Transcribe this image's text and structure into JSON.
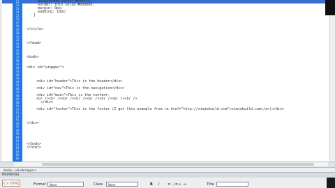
{
  "line_numbers": [
    "21",
    "22",
    "23",
    "24",
    "25",
    "26",
    "27",
    "28",
    "29",
    "30",
    "31",
    "32",
    "33",
    "34",
    "35",
    "36",
    "37",
    "38",
    "39",
    "40",
    "41",
    "42",
    "43",
    "44",
    "45",
    "46",
    "47",
    "48",
    "49",
    "50",
    "51",
    "52",
    "53",
    "54",
    "55",
    "56",
    "57",
    "58",
    "59",
    "60",
    "61",
    "62",
    "63",
    "64",
    "65",
    "66"
  ],
  "code_lines": [
    {
      "text": "background-color: #FFFFCC;",
      "indent": 54,
      "row": 0
    },
    {
      "text": "border: thin solid #000000;",
      "indent": 54,
      "row": 1
    },
    {
      "text": "margin: 0px;",
      "indent": 54,
      "row": 2
    },
    {
      "text": "padding: 10px;",
      "indent": 54,
      "row": 3
    },
    {
      "text": "}",
      "indent": 48,
      "row": 4
    },
    {
      "text": "</style>",
      "indent": 38,
      "row": 8
    },
    {
      "text": "</head>",
      "indent": 38,
      "row": 12
    },
    {
      "text": "<body>",
      "indent": 38,
      "row": 16
    },
    {
      "text": "<div id=\"wrapper\">",
      "indent": 38,
      "row": 19
    },
    {
      "text": "<div id=\"header\">This is the header</div>",
      "indent": 52,
      "row": 23
    },
    {
      "text": "<div id=\"nav\">This is the navigation</div>",
      "indent": 52,
      "row": 25
    },
    {
      "text": "<div id=\"main\">This is the content.",
      "indent": 52,
      "row": 27
    },
    {
      "text": "<br /><br /><br /><br /><br /><br /><br /><br />",
      "indent": 52,
      "row": 28
    },
    {
      "text": "</div>",
      "indent": 58,
      "row": 29
    },
    {
      "text": "<div id=\"footer\">This is the footer (I got this example from <a href=\"http://simiebuild.com\">simiebuild.com</a>)</div>",
      "indent": 52,
      "row": 31
    },
    {
      "text": "</div>",
      "indent": 38,
      "row": 35
    },
    {
      "text": "</body>",
      "indent": 38,
      "row": 41
    },
    {
      "text": "</html>",
      "indent": 38,
      "row": 42
    }
  ],
  "tag_selector": "<body> <div#wrapper>",
  "properties": {
    "panel_title": "PROPERTIES",
    "html_button": "<> HTML",
    "format_label": "Format",
    "format_value": "None",
    "class_label": "Class",
    "class_value": "None",
    "bold": "B",
    "italic": "I",
    "title_label": "Title"
  }
}
